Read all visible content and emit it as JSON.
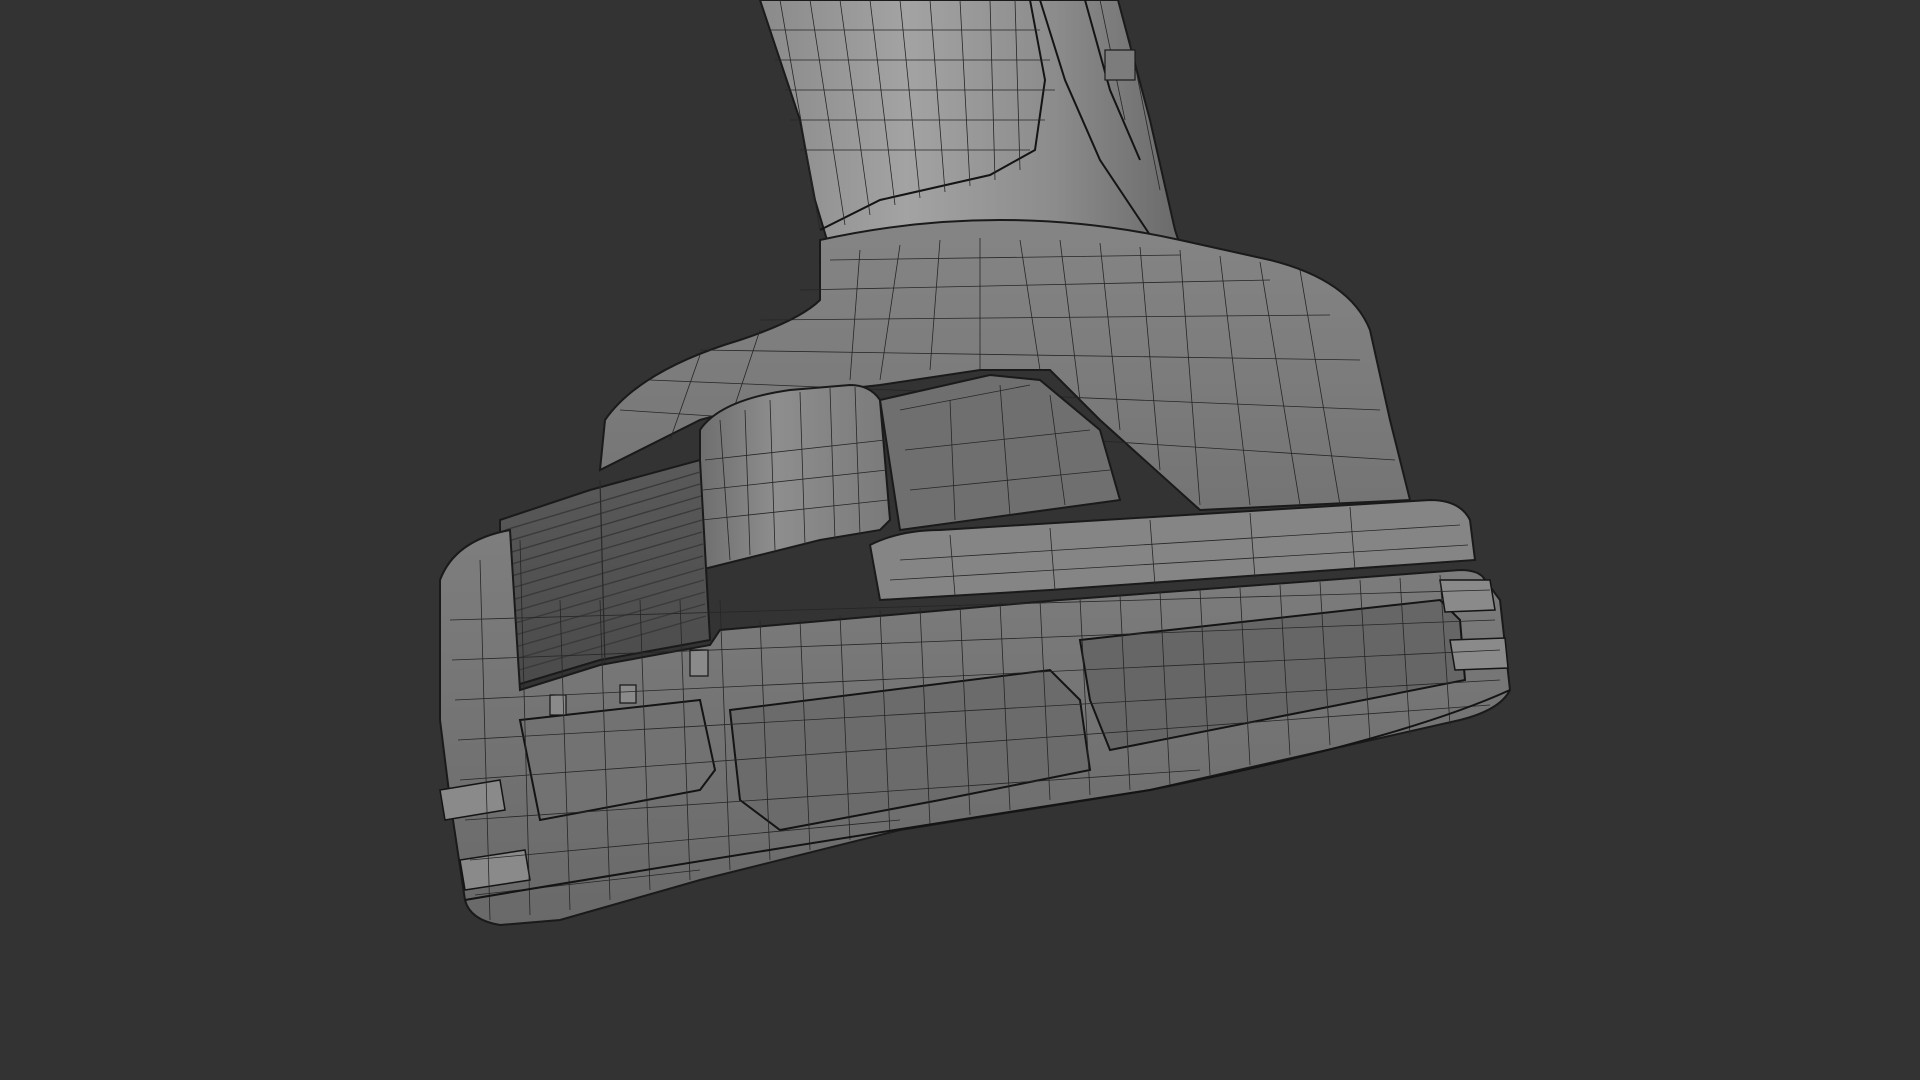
{
  "viewport": {
    "background_color": "#333333",
    "mesh_base_color": "#7a7a7a",
    "mesh_light_color": "#9a9a9a",
    "mesh_dark_color": "#4a4a4a",
    "wire_color": "#1c1c1c"
  },
  "model": {
    "subject": "drill-battery-base-wireframe"
  }
}
